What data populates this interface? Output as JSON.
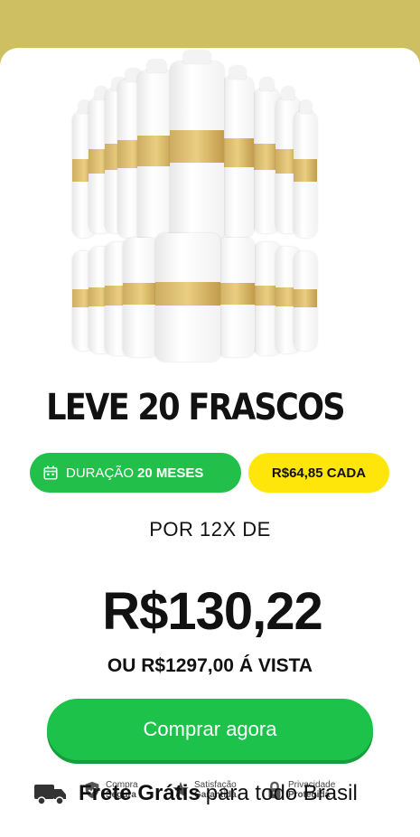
{
  "hero": {
    "headline": "LEVE 20 FRASCOS"
  },
  "offer": {
    "duration_label": "DURAÇÃO",
    "duration_value": "20 MESES",
    "unit_price": "R$64,85 CADA"
  },
  "pricing": {
    "installments_label": "POR 12X DE",
    "installment_price": "R$130,22",
    "cash_price": "OU R$1297,00 Á VISTA"
  },
  "cta": {
    "buy_label": "Comprar agora"
  },
  "trust": {
    "items": [
      {
        "line1": "Compra",
        "line2": "Segura",
        "icon": "shield-check-icon"
      },
      {
        "line1": "Satisfação",
        "line2": "Garantida",
        "icon": "star-badge-icon"
      },
      {
        "line1": "Privacidade",
        "line2": "Protegida",
        "icon": "lock-icon"
      }
    ]
  },
  "shipping": {
    "bold": "Frete Grátis",
    "rest": "para todo Brasil",
    "icon": "truck-icon"
  },
  "colors": {
    "top_band": "#cfbf63",
    "green": "#22c04b",
    "yellow": "#ffe60a"
  }
}
